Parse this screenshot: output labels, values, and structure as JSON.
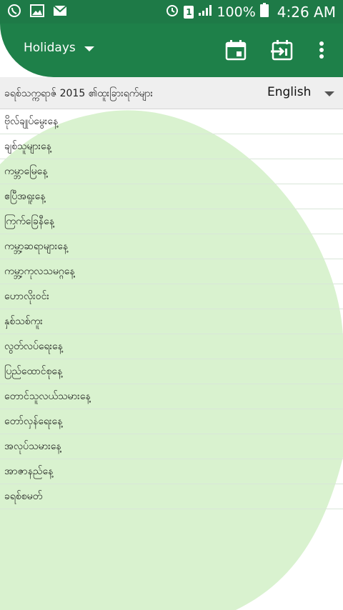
{
  "status_bar": {
    "battery": "100%",
    "time": "4:26 AM",
    "sim_slot": "1"
  },
  "app_bar": {
    "title": "Holidays"
  },
  "list_header": {
    "title": "ခရစ်သက္ကရာဇ် 2015 ၏ထူးခြားရက်များ",
    "language": "English"
  },
  "holidays": [
    "ဗိုလ်ချုပ်မွေးနေ့",
    "ချစ်သူများနေ့",
    "ကမ္ဘာမြေနေ့",
    "ဧပြီအရူးနေ့",
    "ကြက်ခြေနီနေ့",
    "ကမ္ဘာ့ဆရာများနေ့",
    "ကမ္ဘာ့ကုလသမဂ္ဂနေ့",
    "ဟောလိုးဝင်း",
    "နှစ်သစ်ကူး",
    "လွတ်လပ်ရေးနေ့",
    "ပြည်ထောင်စုနေ့",
    "တောင်သူလယ်သမားနေ့",
    "တော်လှန်ရေးနေ့",
    "အလုပ်သမားနေ့",
    "အာဇာနည်နေ့",
    "ခရစ်စမတ်"
  ],
  "colors": {
    "primary": "#1e8049",
    "status": "#1e7a47",
    "accent_light": "#d9f2cf"
  }
}
